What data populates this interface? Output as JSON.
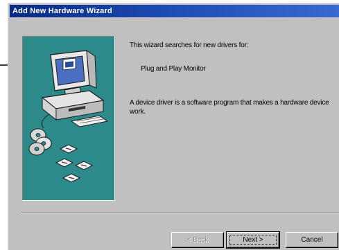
{
  "window": {
    "title": "Add New Hardware Wizard"
  },
  "content": {
    "intro": "This wizard searches for new drivers for:",
    "device_name": "Plug and Play Monitor",
    "description": "A device driver is a software program that makes a hardware device work."
  },
  "buttons": {
    "back_label": "< Back",
    "next_label": "Next >",
    "cancel_label": "Cancel"
  },
  "illustration": {
    "subject": "computer-with-driver-discs",
    "background_color": "#2d8a8a"
  },
  "colors": {
    "titlebar": "#0a2a86",
    "dialog_face": "#c0c0c0"
  }
}
